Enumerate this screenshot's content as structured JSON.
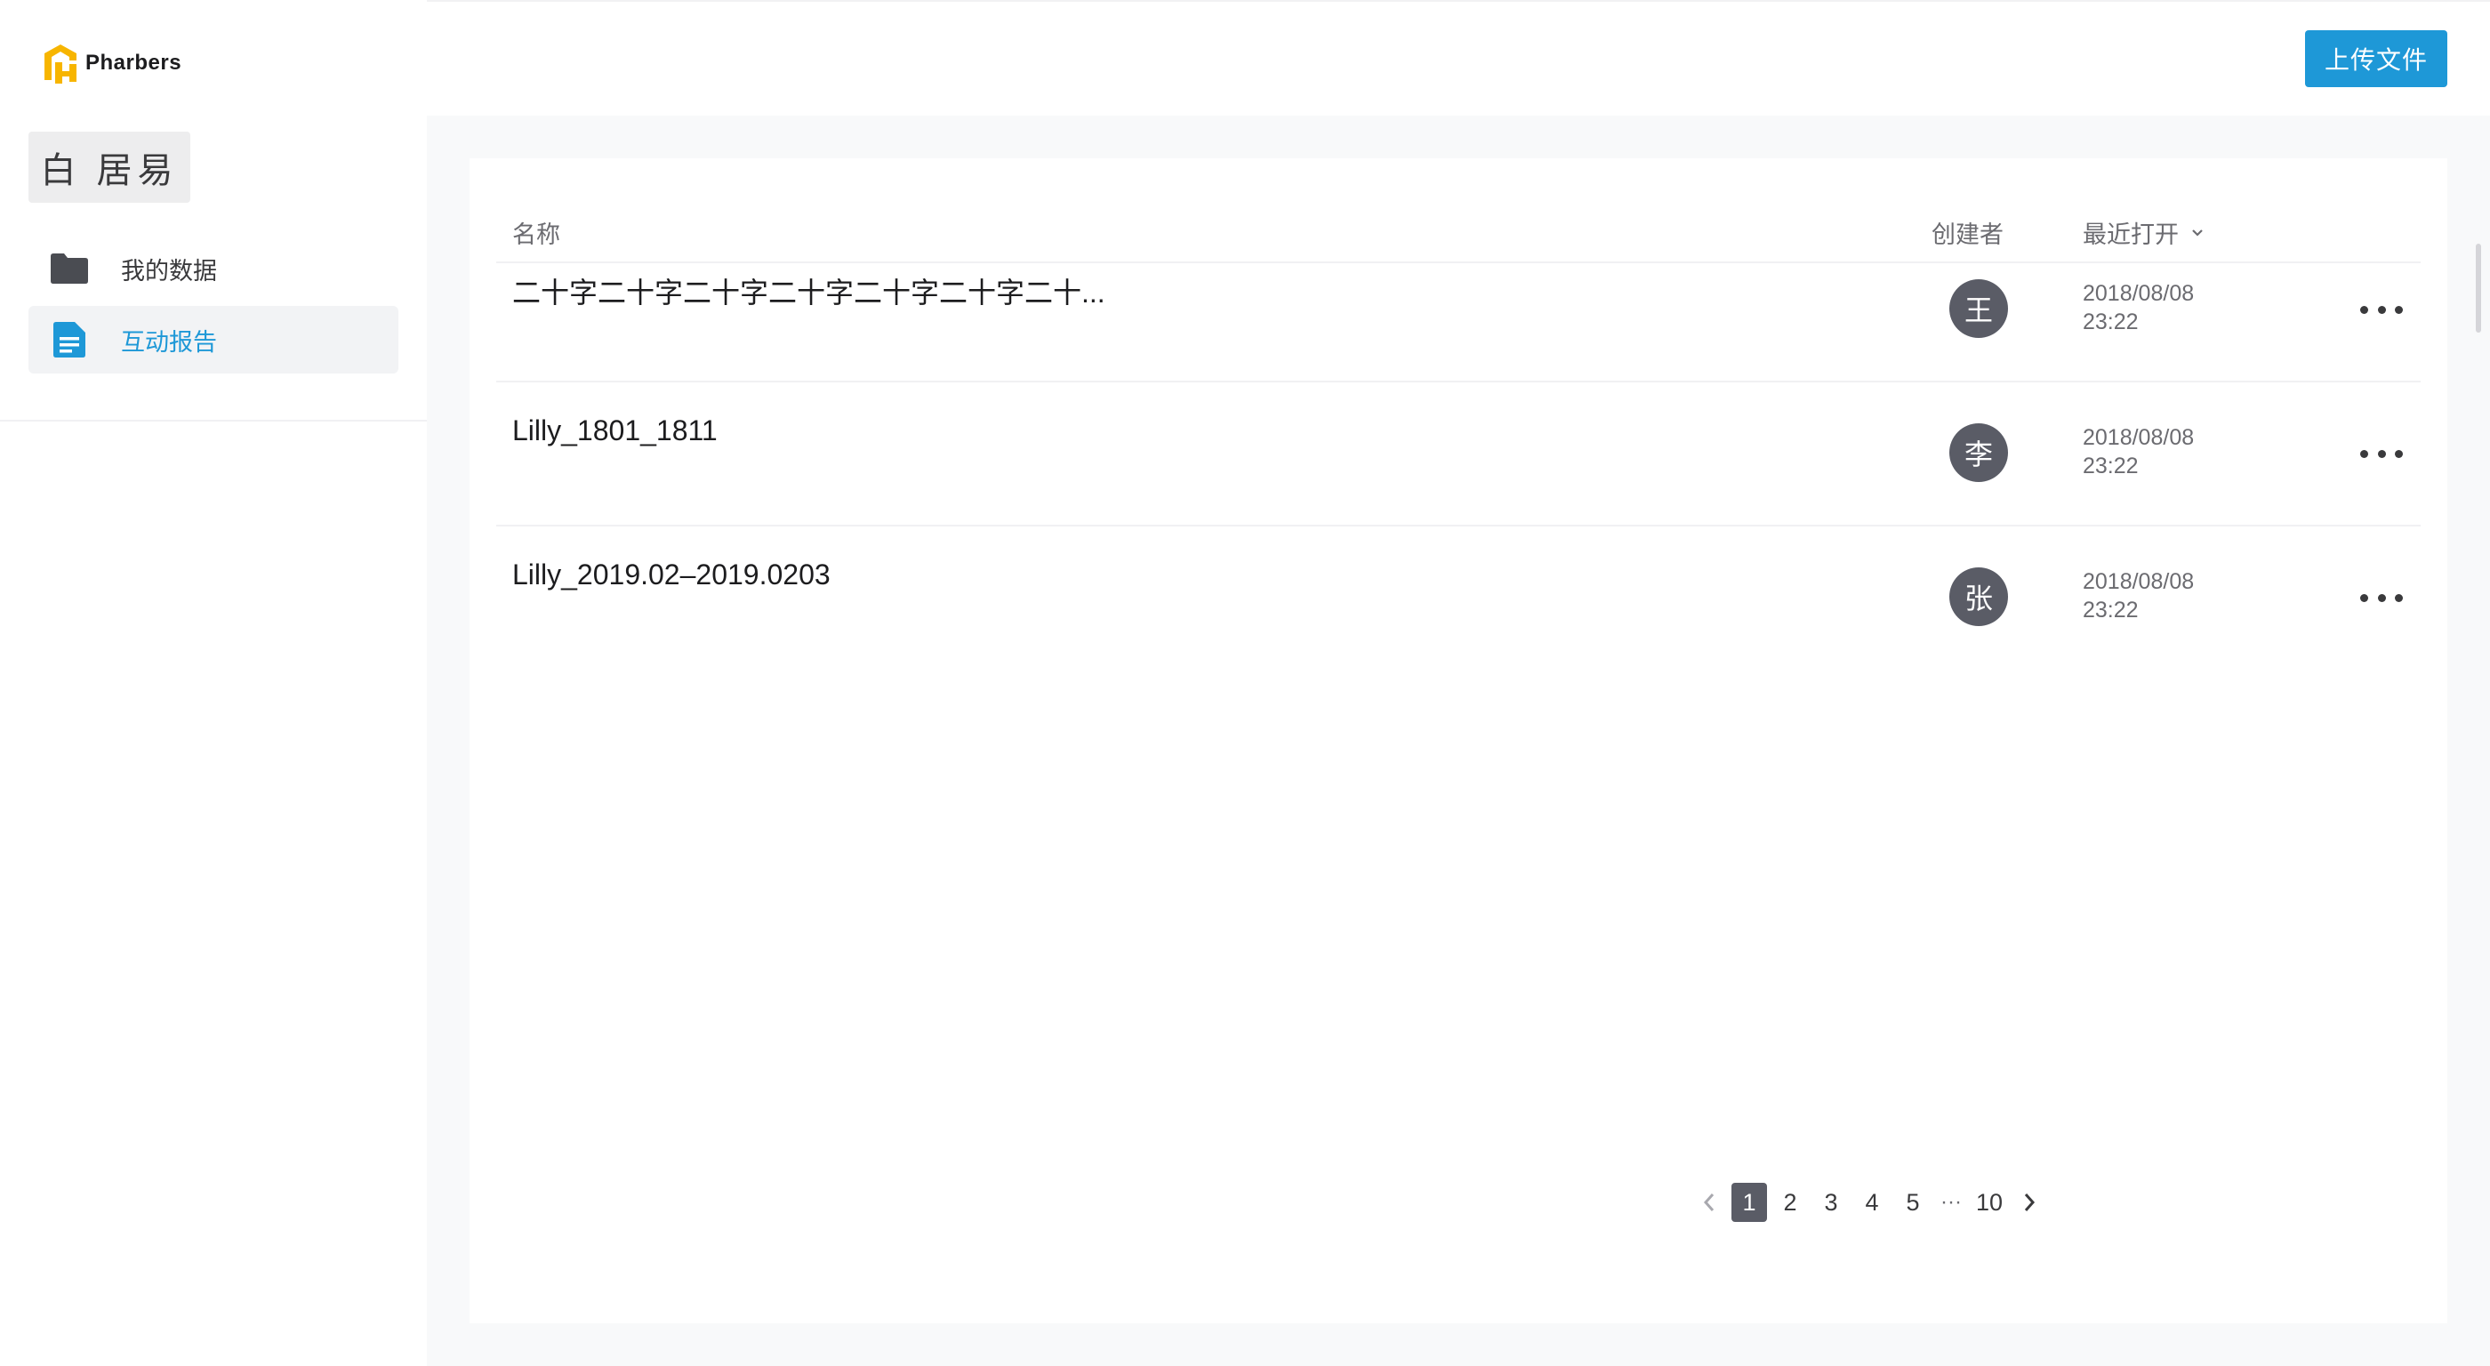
{
  "app": {
    "brand": "Pharbers",
    "brand_color": "#f7b500",
    "accent_color": "#1e98d7"
  },
  "sidebar": {
    "user_name": "白 居易",
    "items": [
      {
        "label": "我的数据",
        "icon": "folder-icon",
        "active": false
      },
      {
        "label": "互动报告",
        "icon": "document-icon",
        "active": true
      }
    ]
  },
  "toolbar": {
    "upload_label": "上传文件"
  },
  "table": {
    "columns": {
      "name": "名称",
      "creator": "创建者",
      "recent": "最近打开"
    },
    "rows": [
      {
        "name": "二十字二十字二十字二十字二十字二十字二十...",
        "creator": "王",
        "date": "2018/08/08",
        "time": "23:22"
      },
      {
        "name": "Lilly_1801_1811",
        "creator": "李",
        "date": "2018/08/08",
        "time": "23:22"
      },
      {
        "name": "Lilly_2019.02–2019.0203",
        "creator": "张",
        "date": "2018/08/08",
        "time": "23:22"
      }
    ]
  },
  "pagination": {
    "pages": [
      "1",
      "2",
      "3",
      "4",
      "5"
    ],
    "ellipsis": "···",
    "last": "10",
    "current": "1"
  }
}
